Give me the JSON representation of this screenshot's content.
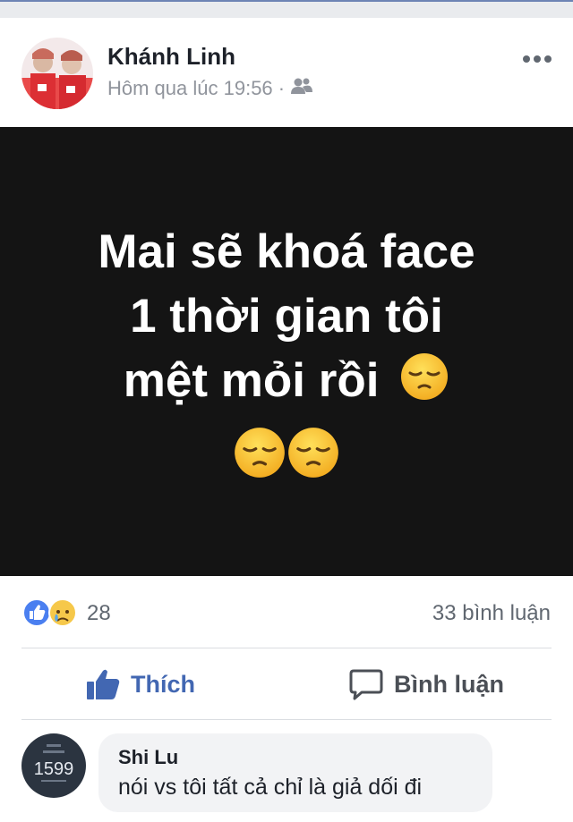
{
  "post": {
    "author": "Khánh Linh",
    "timestamp": "Hôm qua lúc 19:56 ·",
    "audience_icon": "friends-icon",
    "more_icon": "more-dots-icon"
  },
  "content": {
    "lines": [
      "Mai sẽ khoá face",
      "1 thời gian tôi",
      "mệt mỏi rồi"
    ],
    "emoji_name": "pensive-face-icon",
    "background_color": "#141414",
    "text_color": "#ffffff"
  },
  "stats": {
    "reaction_icons": [
      "like-reaction-icon",
      "sad-reaction-icon"
    ],
    "reaction_count": "28",
    "comment_count": "33 bình luận"
  },
  "actions": {
    "like_label": "Thích",
    "comment_label": "Bình luận",
    "accent_color": "#4267b2"
  },
  "comment": {
    "name": "Shi Lu",
    "text": "nói vs tôi tất cả chỉ là giả dối đi",
    "avatar_text": "1599"
  }
}
